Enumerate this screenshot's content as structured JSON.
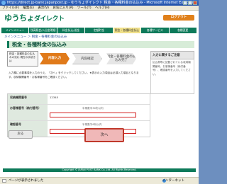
{
  "window": {
    "title": "https://direct.jp-bank.japanpost.jp - ゆうちょダイレクト 税金・各種料金の払込み - Microsoft Internet Explorer"
  },
  "menubar": [
    "ファイル(F)",
    "編集(E)",
    "表示(V)",
    "お気に入り(A)",
    "ツール(T)",
    "ヘルプ(H)"
  ],
  "header": {
    "logo": "ゆうちょ",
    "logo_suffix": "ダイレクト",
    "logout": "ログアウト"
  },
  "navbar": [
    "メインメニュー",
    "残高照会/入出金明細",
    "料金払込/送金",
    "定額貯金",
    "税金・各種料金払込",
    "各種サービス",
    "各種変更"
  ],
  "breadcrumb": "メインメニュー ＞ 税金・各種料金の払込み",
  "page_title": "税金・各種料金の払込み",
  "stepper": {
    "step0": "税金・各種料金の払込みの流れ 現在の手続きは",
    "step1": "内容入力",
    "step2": "内容確認",
    "step3": "税金・各種料金の払込み完了"
  },
  "intro": "入力欄に必要事項を入力のうえ、「次へ」をクリックしてください。★表示の入力項目は必須入力項目となります。収納機関番号・お客様番号をご確認ください。",
  "form": {
    "rows": [
      {
        "label": "収納機関番号",
        "value": "12345",
        "hint": ""
      },
      {
        "label": "お客様番号（納付番号）",
        "value": "",
        "hint": "半角数字30桁以内"
      },
      {
        "label": "確認番号",
        "value": "",
        "hint": "半角数字6桁以内"
      }
    ]
  },
  "buttons": {
    "back": "戻る",
    "next": "次へ"
  },
  "side": {
    "title": "入力に関するご注意",
    "text": "払込書等に記載されている収納機関番号、お客様番号（納付番号）、確認番号を入力してください。"
  },
  "footer": "Copyright © JAPAN POST BANK Co.,Ltd. All Rights Reserved.",
  "statusbar": {
    "text": "ページが表示されました",
    "zone": "インターネット"
  }
}
